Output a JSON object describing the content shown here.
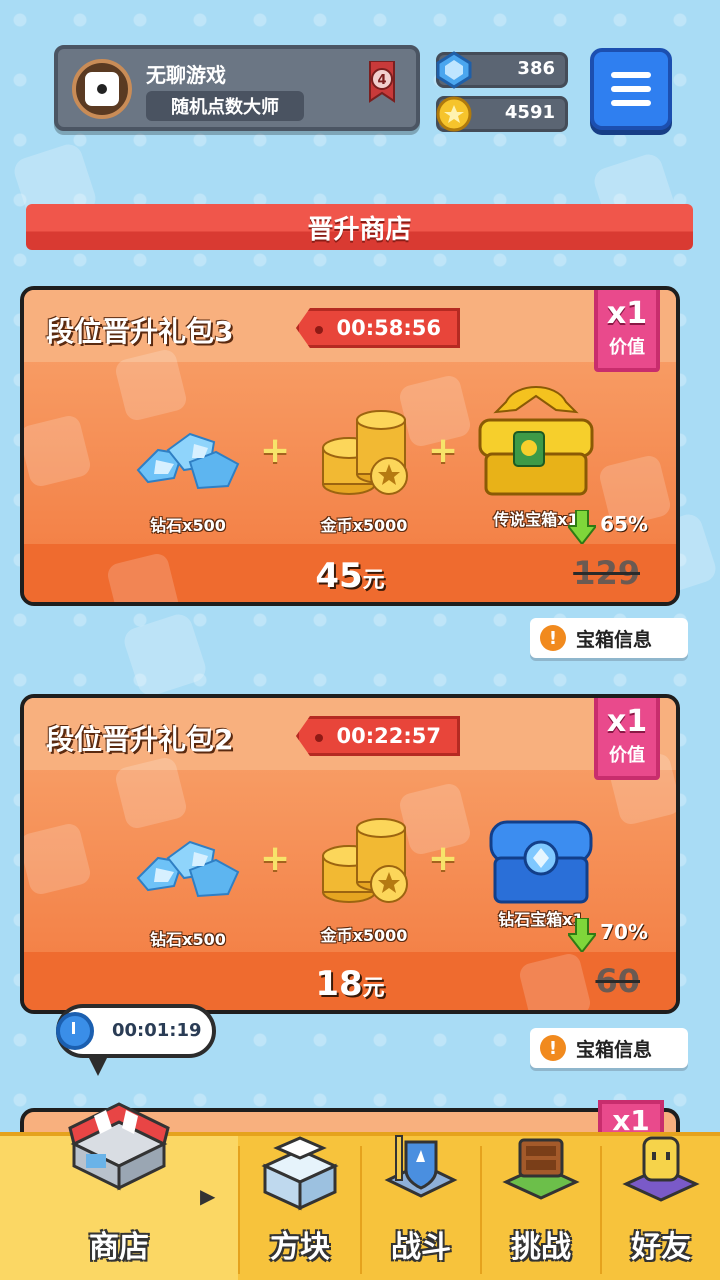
{
  "header": {
    "player_name": "无聊游戏",
    "player_title": "随机点数大师",
    "rank_level": "4",
    "diamonds": "386",
    "coins": "4591"
  },
  "section_title": "晋升商店",
  "packs": [
    {
      "name": "段位晋升礼包3",
      "timer": "00:58:56",
      "multiplier": "x1",
      "multiplier_label": "价值",
      "items": [
        {
          "label": "钻石x500",
          "icon": "diamond-pile-icon"
        },
        {
          "label": "金币x5000",
          "icon": "coin-stack-icon"
        },
        {
          "label": "传说宝箱x1",
          "icon": "legendary-chest-icon"
        }
      ],
      "price": "45",
      "currency": "元",
      "discount": "65%",
      "old_price": "129",
      "info_label": "宝箱信息"
    },
    {
      "name": "段位晋升礼包2",
      "timer": "00:22:57",
      "multiplier": "x1",
      "multiplier_label": "价值",
      "items": [
        {
          "label": "钻石x500",
          "icon": "diamond-pile-icon"
        },
        {
          "label": "金币x5000",
          "icon": "coin-stack-icon"
        },
        {
          "label": "钻石宝箱x1",
          "icon": "diamond-chest-icon"
        }
      ],
      "price": "18",
      "currency": "元",
      "discount": "70%",
      "old_price": "60",
      "info_label": "宝箱信息"
    }
  ],
  "next_pack_multiplier": "x1",
  "shop_timer": "00:01:19",
  "nav": [
    {
      "label": "商店",
      "icon": "shop-icon",
      "active": true
    },
    {
      "label": "方块",
      "icon": "cube-icon"
    },
    {
      "label": "战斗",
      "icon": "battle-icon"
    },
    {
      "label": "挑战",
      "icon": "challenge-icon"
    },
    {
      "label": "好友",
      "icon": "friends-icon"
    }
  ],
  "colors": {
    "background": "#a9dcf5",
    "section_red": "#f0564b",
    "card_orange": "#f27a3f",
    "multiplier_pink": "#e94a8c",
    "nav_yellow": "#f7c33c",
    "menu_blue": "#2f7ff0"
  }
}
